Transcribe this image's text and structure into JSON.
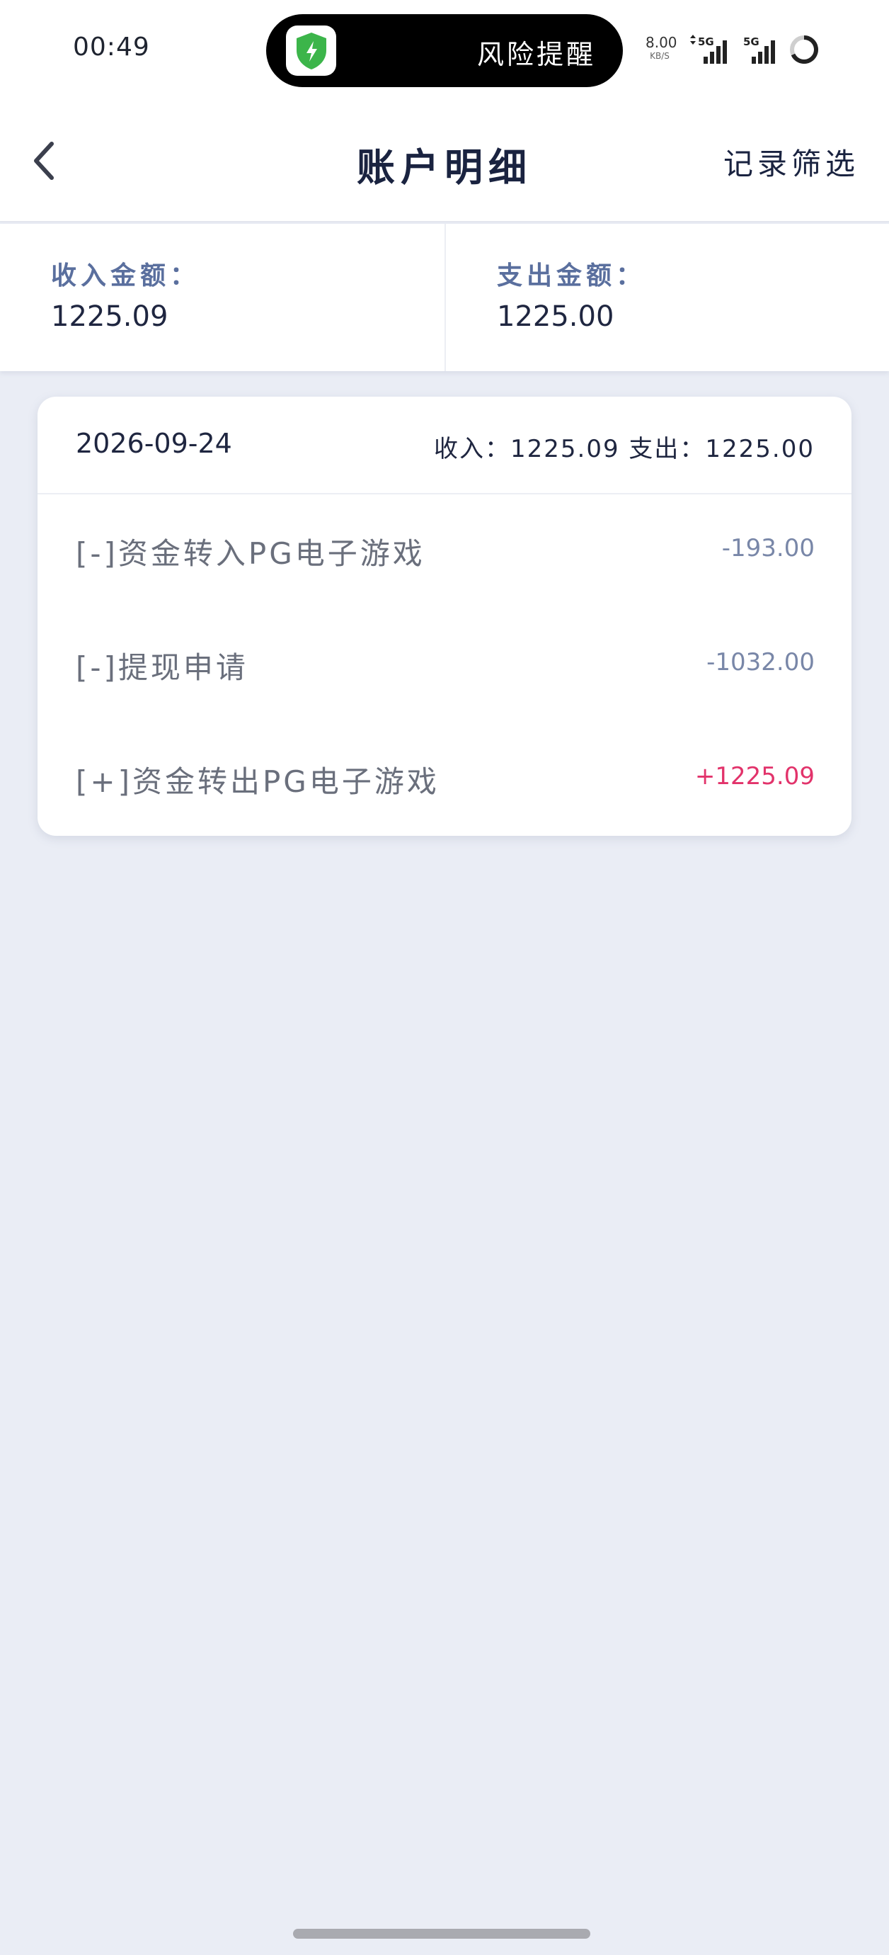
{
  "status_bar": {
    "time": "00:49",
    "pill_text": "风险提醒",
    "net_speed_value": "8.00",
    "net_speed_unit": "KB/S",
    "signal_1_label": "5G",
    "signal_2_label": "5G",
    "app_icon": "shield-bolt-icon",
    "accent_color": "#3cb54a"
  },
  "nav": {
    "title": "账户明细",
    "filter_label": "记录筛选",
    "back_icon": "chevron-left-icon"
  },
  "summary": {
    "income_label": "收入金额：",
    "income_value": "1225.09",
    "expense_label": "支出金额：",
    "expense_value": "1225.00"
  },
  "day_group": {
    "date": "2026-09-24",
    "totals": "收入：1225.09 支出：1225.00",
    "records": [
      {
        "label": "[-]资金转入PG电子游戏",
        "amount": "-193.00"
      },
      {
        "label": "[-]提现申请",
        "amount": "-1032.00"
      },
      {
        "label": "[+]资金转出PG电子游戏",
        "amount": "+1225.09"
      }
    ]
  },
  "colors": {
    "positive": "#e2336b",
    "negative": "#7987a8",
    "label_accent": "#5a6f9e",
    "background": "#eaedf5"
  }
}
